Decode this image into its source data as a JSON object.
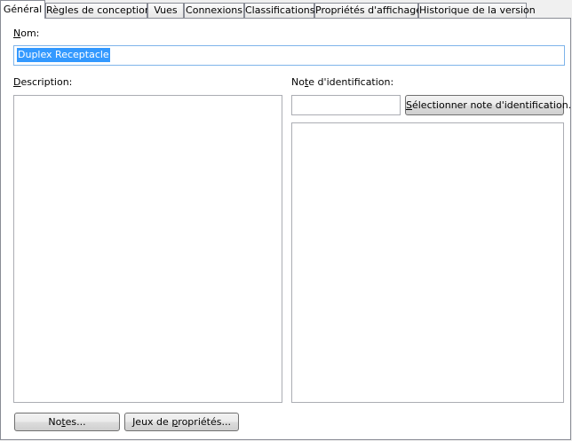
{
  "tabs": [
    {
      "label": "Général",
      "active": true
    },
    {
      "label": "Règles de conception"
    },
    {
      "label": "Vues"
    },
    {
      "label": "Connexions"
    },
    {
      "label": "Classifications"
    },
    {
      "label": "Propriétés d'affichage"
    },
    {
      "label": "Historique de la version"
    }
  ],
  "general": {
    "name_label_first": "N",
    "name_label_rest": "om:",
    "name_value": "Duplex Receptacle",
    "description_label_first": "D",
    "description_label_rest": "escription:",
    "description_value": "",
    "key_note_label_pre": "No",
    "key_note_label_u": "t",
    "key_note_label_post": "e d'identification:",
    "key_note_value": "",
    "select_key_note_button_first": "S",
    "select_key_note_button_rest": "électionner note d'identification...",
    "key_note_details_value": "",
    "notes_button_pre": "No",
    "notes_button_u": "t",
    "notes_button_post": "es...",
    "property_sets_button_pre": "Jeux de ",
    "property_sets_button_u": "p",
    "property_sets_button_post": "ropriétés..."
  }
}
